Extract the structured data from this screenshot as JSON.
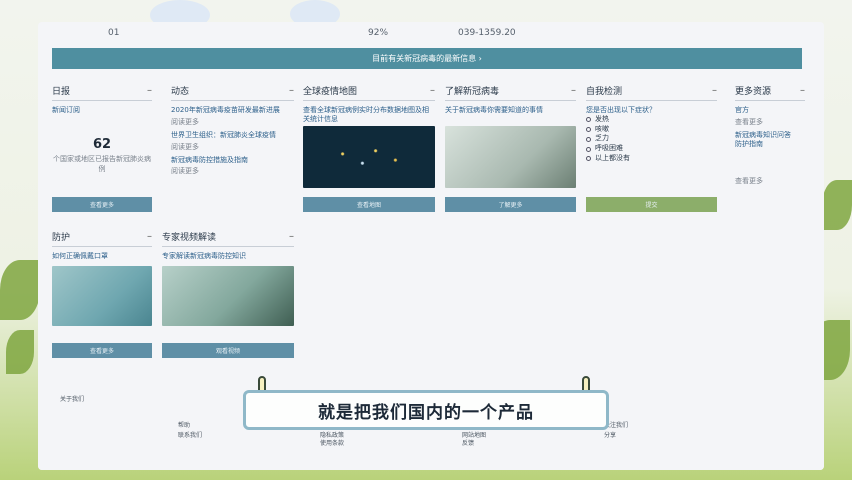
{
  "top_strip": {
    "a": "01",
    "b": "92%",
    "c": "039-1359.20"
  },
  "banner": {
    "text": "目前有关新冠病毒的最新信息 ›"
  },
  "cards": {
    "news": {
      "title": "日报",
      "link": "新闻订阅",
      "number": "62",
      "caption": "个国家或地区已报告新冠肺炎病例",
      "button": "查看更多"
    },
    "updates": {
      "title": "动态",
      "items": [
        {
          "link": "2020年新冠病毒疫苗研发最新进展",
          "meta": "阅读更多"
        },
        {
          "link": "世界卫生组织：新冠肺炎全球疫情",
          "meta": "阅读更多"
        },
        {
          "link": "新冠病毒防控措施及指南",
          "meta": "阅读更多"
        }
      ]
    },
    "global": {
      "title": "全球疫情地图",
      "link": "查看全球新冠病例实时分布数据地图及相关统计信息",
      "button": "查看地图"
    },
    "knowledge": {
      "title": "了解新冠病毒",
      "link": "关于新冠病毒你需要知道的事情",
      "button": "了解更多"
    },
    "survey": {
      "title": "自我检测",
      "question": "您是否出现以下症状？",
      "options": [
        "发热",
        "咳嗽",
        "乏力",
        "呼吸困难",
        "以上都没有"
      ],
      "button": "提交"
    },
    "resources": {
      "title": "更多资源",
      "items": [
        "官方",
        "查看更多",
        "新冠病毒知识问答",
        "防护指南",
        "查看更多"
      ]
    },
    "prevent": {
      "title": "防护",
      "link": "如何正确佩戴口罩",
      "button": "查看更多"
    },
    "video": {
      "title": "专家视频解读",
      "link": "专家解读新冠病毒防控知识",
      "button": "观看视频"
    }
  },
  "footer": {
    "left_label": "关于我们",
    "cols": [
      {
        "title": "帮助",
        "items": [
          "联系我们"
        ]
      },
      {
        "title": "隐私政策",
        "items": [
          "使用条款"
        ]
      },
      {
        "title": "网站地图",
        "items": [
          "反馈"
        ]
      },
      {
        "title": "关注我们",
        "items": [
          "分享"
        ]
      }
    ]
  },
  "subtitle": {
    "text": "就是把我们国内的一个产品"
  }
}
